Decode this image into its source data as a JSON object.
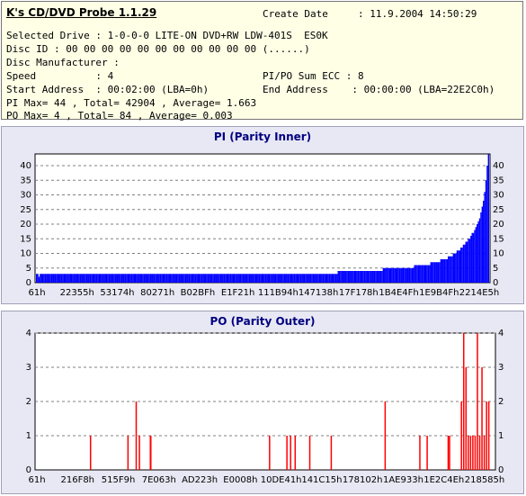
{
  "info": {
    "app_title": "K's CD/DVD Probe 1.1.29",
    "create_date": "Create Date     : 11.9.2004 14:50:29",
    "drive": "Selected Drive : 1-0-0-0 LITE-ON DVD+RW LDW-401S  ES0K",
    "disc_id": "Disc ID : 00 00 00 00 00 00 00 00 00 00 00 (......)",
    "manufacturer": "Disc Manufacturer :",
    "speed": "Speed          : 4",
    "sum_ecc": "PI/PO Sum ECC : 8",
    "start_address": "Start Address  : 00:02:00 (LBA=0h)",
    "end_address": "End Address    : 00:00:00 (LBA=22E2C0h)",
    "pi_stats": "PI Max= 44 , Total= 42904 , Average= 1.663",
    "po_stats": "PO Max= 4 , Total= 84 , Average= 0.003"
  },
  "chart_data": [
    {
      "type": "bar",
      "title": "PI (Parity Inner)",
      "ylim": [
        0,
        44
      ],
      "y_ticks": [
        0,
        5,
        10,
        15,
        20,
        25,
        30,
        35,
        40
      ],
      "x_ticks": [
        "61h",
        "22355h",
        "53174h",
        "80271h",
        "B02BFh",
        "E1F21h",
        "111B94h",
        "147138h",
        "17F178h",
        "1B4E4Fh",
        "1E9B4Fh",
        "2214E5h"
      ],
      "grid": true,
      "bar_color": "#0000ff",
      "values": [
        3,
        3,
        2,
        3,
        3,
        3,
        3,
        3,
        3,
        3,
        3,
        3,
        3,
        3,
        3,
        3,
        3,
        3,
        3,
        3,
        3,
        3,
        3,
        3,
        3,
        3,
        3,
        3,
        3,
        3,
        3,
        3,
        3,
        3,
        3,
        3,
        3,
        3,
        3,
        3,
        3,
        3,
        3,
        3,
        3,
        3,
        3,
        3,
        3,
        3,
        3,
        3,
        3,
        3,
        3,
        3,
        3,
        3,
        3,
        3,
        3,
        3,
        3,
        3,
        3,
        3,
        3,
        3,
        3,
        3,
        3,
        3,
        3,
        3,
        3,
        3,
        3,
        3,
        3,
        3,
        3,
        3,
        3,
        3,
        3,
        3,
        3,
        3,
        3,
        3,
        3,
        3,
        3,
        3,
        3,
        3,
        3,
        3,
        3,
        3,
        3,
        3,
        3,
        3,
        3,
        3,
        3,
        3,
        3,
        3,
        3,
        3,
        3,
        3,
        3,
        3,
        3,
        3,
        3,
        3,
        3,
        3,
        3,
        3,
        3,
        3,
        3,
        3,
        3,
        3,
        3,
        3,
        3,
        3,
        3,
        3,
        3,
        3,
        3,
        3,
        3,
        3,
        3,
        3,
        3,
        3,
        3,
        3,
        3,
        3,
        3,
        3,
        3,
        3,
        3,
        3,
        3,
        3,
        3,
        3,
        3,
        3,
        3,
        3,
        3,
        3,
        3,
        3,
        3,
        3,
        3,
        3,
        3,
        3,
        3,
        3,
        3,
        3,
        3,
        3,
        3,
        3,
        3,
        3,
        3,
        3,
        3,
        3,
        3,
        3,
        3,
        3,
        3,
        3,
        3,
        3,
        3,
        3,
        3,
        3,
        3,
        3,
        3,
        3,
        3,
        3,
        3,
        3,
        3,
        3,
        3,
        3,
        3,
        3,
        3,
        3,
        3,
        3,
        3,
        3,
        3,
        3,
        3,
        3,
        3,
        3,
        3,
        3,
        3,
        3,
        3,
        3,
        3,
        3,
        3,
        3,
        3,
        3,
        3,
        3,
        3,
        4,
        4,
        4,
        4,
        4,
        4,
        4,
        4,
        4,
        4,
        4,
        4,
        4,
        4,
        4,
        4,
        4,
        4,
        4,
        4,
        4,
        4,
        4,
        4,
        4,
        4,
        4,
        4,
        4,
        4,
        4,
        4,
        4,
        4,
        4,
        4,
        5,
        5,
        5,
        5,
        5,
        5,
        5,
        5,
        5,
        5,
        5,
        5,
        5,
        5,
        5,
        5,
        5,
        5,
        5,
        5,
        5,
        5,
        5,
        5,
        5,
        6,
        6,
        6,
        6,
        6,
        6,
        6,
        6,
        6,
        6,
        6,
        6,
        6,
        7,
        7,
        7,
        7,
        7,
        7,
        7,
        7,
        8,
        8,
        8,
        8,
        8,
        8,
        9,
        9,
        9,
        9,
        10,
        10,
        10,
        11,
        11,
        11,
        12,
        12,
        13,
        13,
        14,
        14,
        15,
        15,
        16,
        17,
        17,
        18,
        19,
        20,
        21,
        22,
        24,
        26,
        28,
        31,
        35,
        40,
        44
      ],
      "bar_thresholds_note": ""
    },
    {
      "type": "bar",
      "title": "PO (Parity Outer)",
      "ylim": [
        0,
        4
      ],
      "y_ticks": [
        0,
        1,
        2,
        3,
        4
      ],
      "x_ticks": [
        "61h",
        "216F8h",
        "515F9h",
        "7E063h",
        "AD223h",
        "E0008h",
        "10DE41h",
        "141C15h",
        "178102h",
        "1AE933h",
        "1E2C4Eh",
        "218585h"
      ],
      "grid": true,
      "bar_color": "#ff0000",
      "points": [
        [
          0.118,
          1
        ],
        [
          0.2,
          1
        ],
        [
          0.218,
          2
        ],
        [
          0.225,
          1
        ],
        [
          0.249,
          1
        ],
        [
          0.25,
          1
        ],
        [
          0.51,
          1
        ],
        [
          0.548,
          1
        ],
        [
          0.556,
          1
        ],
        [
          0.566,
          1
        ],
        [
          0.598,
          1
        ],
        [
          0.645,
          1
        ],
        [
          0.763,
          2
        ],
        [
          0.839,
          1
        ],
        [
          0.855,
          1
        ],
        [
          0.901,
          1
        ],
        [
          0.904,
          1
        ],
        [
          0.93,
          2
        ],
        [
          0.935,
          4
        ],
        [
          0.94,
          3
        ],
        [
          0.945,
          1
        ],
        [
          0.95,
          1
        ],
        [
          0.955,
          1
        ],
        [
          0.96,
          1
        ],
        [
          0.965,
          4
        ],
        [
          0.97,
          1
        ],
        [
          0.975,
          3
        ],
        [
          0.98,
          1
        ],
        [
          0.985,
          2
        ],
        [
          0.99,
          2
        ]
      ]
    }
  ]
}
